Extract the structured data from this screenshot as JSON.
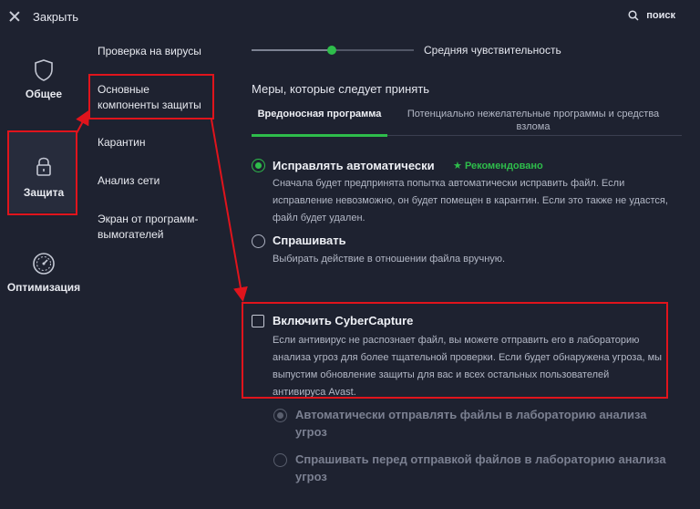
{
  "header": {
    "close_label": "Закрыть",
    "search_label": "поиск"
  },
  "nav": {
    "items": [
      {
        "label": "Общее",
        "icon": "shield-icon"
      },
      {
        "label": "Защита",
        "icon": "lock-icon"
      },
      {
        "label": "Оптимизация",
        "icon": "speedometer-icon"
      }
    ],
    "active": "Защита"
  },
  "subnav": {
    "items": [
      "Проверка на вирусы",
      "Основные компоненты защиты",
      "Карантин",
      "Анализ сети",
      "Экран от программ-вымогателей"
    ],
    "active": "Основные компоненты защиты"
  },
  "sensitivity": {
    "label": "Средняя чувствительность",
    "level": 0.5
  },
  "measures": {
    "title": "Меры, которые следует принять",
    "tabs": [
      {
        "label": "Вредоносная программа",
        "active": true
      },
      {
        "label": "Потенциально нежелательные программы и средства взлома",
        "active": false
      }
    ]
  },
  "options": {
    "auto_fix": {
      "title": "Исправлять автоматически",
      "badge": "Рекомендовано",
      "desc": "Сначала будет предпринята попытка автоматически исправить файл. Если исправление невозможно, он будет помещен в карантин. Если это также не удастся, файл будет удален.",
      "selected": true
    },
    "ask": {
      "title": "Спрашивать",
      "desc": "Выбирать действие в отношении файла вручную.",
      "selected": false
    }
  },
  "cybercapture": {
    "title": "Включить CyberCapture",
    "desc": "Если антивирус не распознает файл, вы можете отправить его в лабораторию анализа угроз для более тщательной проверки. Если будет обнаружена угроза, мы выпустим обновление защиты для вас и всех остальных пользователей антивируса Avast.",
    "checked": false,
    "suboptions": [
      {
        "label": "Автоматически отправлять файлы в лабораторию анализа угроз",
        "selected": true
      },
      {
        "label": "Спрашивать перед отправкой файлов в лабораторию анализа угроз",
        "selected": false
      }
    ]
  },
  "colors": {
    "accent": "#2ebd4b",
    "highlight": "#e0141c",
    "background": "#1e2230"
  }
}
